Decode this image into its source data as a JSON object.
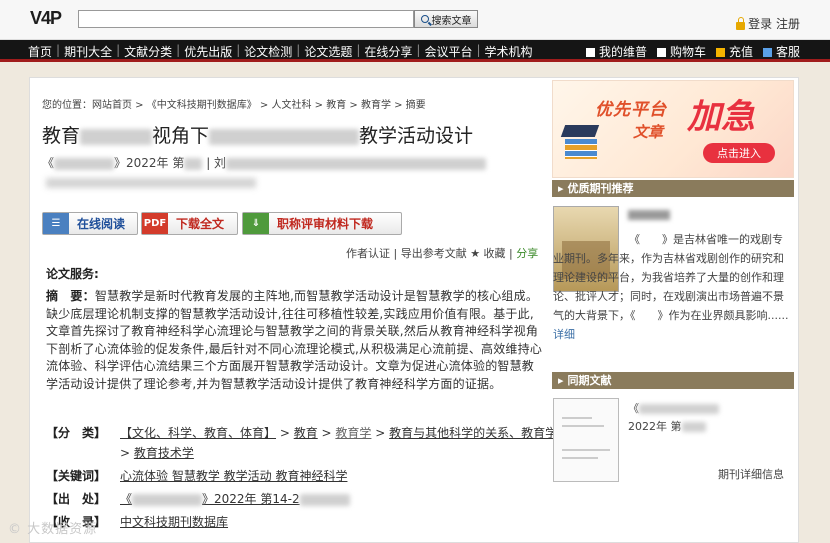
{
  "header": {
    "logo": "V4P",
    "search": {
      "value": "",
      "placeholder": "",
      "button_label": "搜索文章"
    },
    "login_label": "登录 注册"
  },
  "nav": {
    "items": [
      "首页",
      "期刊大全",
      "文献分类",
      "优先出版",
      "论文检测",
      "论文选题",
      "在线分享",
      "会议平台",
      "学术机构"
    ],
    "right": [
      {
        "label": "我的维普",
        "icon": "my-weipu-icon",
        "color": "#ffffff"
      },
      {
        "label": "购物车",
        "icon": "cart-icon",
        "color": "#ffffff"
      },
      {
        "label": "充值",
        "icon": "recharge-icon",
        "color": "#f5b400"
      },
      {
        "label": "客服",
        "icon": "service-icon",
        "color": "#5aa0e8"
      }
    ]
  },
  "breadcrumb": "您的位置：网站首页 > 《中文科技期刊数据库》 > 人文社科 > 教育 > 教育学 > 摘要",
  "article": {
    "title_start": "教育",
    "title_mid": "视角下",
    "title_end": "教学活动设计",
    "source_prefix": "《",
    "source_year": "》2022年 第",
    "source_author_sep": "| 刘"
  },
  "buttons": {
    "read": "在线阅读",
    "download": "下载全文",
    "title_download": "职称评审材料下载"
  },
  "actions": {
    "text": "作者认证 | 导出参考文献 ★ 收藏 | ",
    "share": "分享"
  },
  "abstract": {
    "section_title": "论文服务:",
    "label": "摘　要：",
    "text": "智慧教学是新时代教育发展的主阵地,而智慧教学活动设计是智慧教学的核心组成。缺少底层理论机制支撑的智慧教学活动设计,往往可移植性较差,实践应用价值有限。基于此,文章首先探讨了教育神经科学心流理论与智慧教学之间的背景关联,然后从教育神经科学视角下剖析了心流体验的促发条件,最后针对不同心流理论模式,从积极满足心流前提、高效维持心流体验、科学评估心流结果三个方面展开智慧教学活动设计。文章为促进心流体验的智慧教学活动设计提供了理论参考,并为智慧教学活动设计提供了教育神经科学方面的证据。"
  },
  "meta": {
    "category_label": "【分　类】",
    "category_1": "【文化、科学、教育、体育】",
    "category_2": "教育",
    "category_3": "教育学",
    "category_4": "教育与其他科学的关系、教育学分支",
    "category_5": "教育技术学",
    "keywords_label": "【关键词】",
    "keywords": "心流体验  智慧教学  教学活动  教育神经科学",
    "source_label": "【出　处】",
    "source": "》2022年 第14-2",
    "db_label": "【收　录】",
    "db": "中文科技期刊数据库"
  },
  "sidebar": {
    "promo": {
      "line1": "优先平台",
      "line2": "文章",
      "line3": "加急",
      "button": "点击进入"
    },
    "quality_head": "优质期刊推荐",
    "quality_text": "《　　》是吉林省唯一的戏剧专业期刊。多年来，作为吉林省戏剧创作的研究和理论建设的平台，为我省培养了大量的创作和理论、批评人才；同时，在戏剧演出市场普遍不景气的大背景下，《　　》作为在业界颇具影响......",
    "quality_more": "详细",
    "same_head": "同期文献",
    "same_title": "《",
    "same_year": "2022年 第",
    "same_more": "期刊详细信息"
  },
  "watermark": "©  大数据资源"
}
